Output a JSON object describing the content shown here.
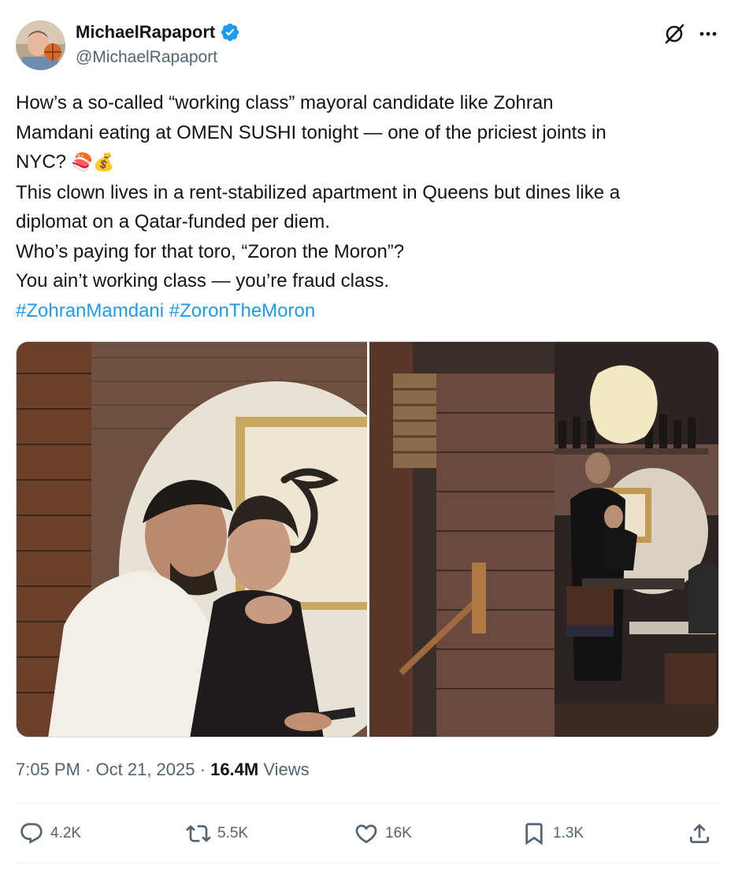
{
  "author": {
    "name": "MichaelRapaport",
    "handle": "@MichaelRapaport",
    "verified": true
  },
  "tweet": {
    "lines": [
      "How’s a so-called “working class” mayoral candidate like Zohran",
      "Mamdani eating at OMEN SUSHI tonight — one of the priciest joints in",
      "NYC?",
      "This clown lives in a rent-stabilized apartment in Queens but dines like a",
      "diplomat on a Qatar-funded per diem.",
      "Who’s paying for that toro, “Zoron the Moron”?",
      "You ain’t working class — you’re fraud class."
    ],
    "emojis": [
      "🍣",
      "💰"
    ],
    "hashtags": [
      "#ZohranMamdani",
      "#ZoronTheMoron"
    ]
  },
  "meta": {
    "time": "7:05 PM",
    "date": "Oct 21, 2025",
    "views_count": "16.4M",
    "views_label": "Views"
  },
  "actions": {
    "reply": "4.2K",
    "repost": "5.5K",
    "like": "16K",
    "bookmark": "1.3K"
  },
  "icons": {
    "verified": "verified-badge-icon",
    "grok": "grok-icon",
    "more": "more-options-icon",
    "reply": "reply-icon",
    "repost": "repost-icon",
    "like": "heart-icon",
    "bookmark": "bookmark-icon",
    "share": "share-icon"
  },
  "colors": {
    "accent": "#1d9bf0",
    "text": "#0f1419",
    "secondary": "#536471"
  }
}
